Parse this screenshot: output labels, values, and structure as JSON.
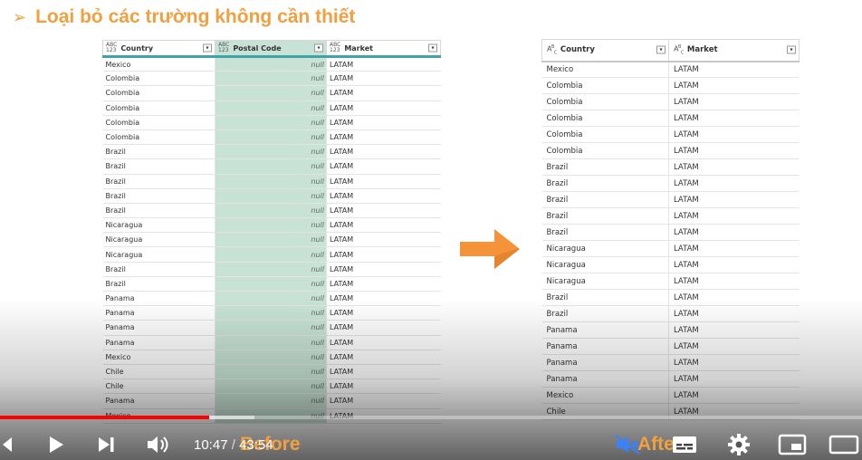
{
  "slide": {
    "bullet": "➢",
    "title": "Loại bỏ các trường không cần thiết"
  },
  "before_table": {
    "columns": [
      {
        "type": "ABC\n123",
        "label": "Country"
      },
      {
        "type": "ABC\n123",
        "label": "Postal Code"
      },
      {
        "type": "ABC\n123",
        "label": "Market"
      }
    ],
    "rows": [
      [
        "Mexico",
        "null",
        "LATAM"
      ],
      [
        "Colombia",
        "null",
        "LATAM"
      ],
      [
        "Colombia",
        "null",
        "LATAM"
      ],
      [
        "Colombia",
        "null",
        "LATAM"
      ],
      [
        "Colombia",
        "null",
        "LATAM"
      ],
      [
        "Colombia",
        "null",
        "LATAM"
      ],
      [
        "Brazil",
        "null",
        "LATAM"
      ],
      [
        "Brazil",
        "null",
        "LATAM"
      ],
      [
        "Brazil",
        "null",
        "LATAM"
      ],
      [
        "Brazil",
        "null",
        "LATAM"
      ],
      [
        "Brazil",
        "null",
        "LATAM"
      ],
      [
        "Nicaragua",
        "null",
        "LATAM"
      ],
      [
        "Nicaragua",
        "null",
        "LATAM"
      ],
      [
        "Nicaragua",
        "null",
        "LATAM"
      ],
      [
        "Brazil",
        "null",
        "LATAM"
      ],
      [
        "Brazil",
        "null",
        "LATAM"
      ],
      [
        "Panama",
        "null",
        "LATAM"
      ],
      [
        "Panama",
        "null",
        "LATAM"
      ],
      [
        "Panama",
        "null",
        "LATAM"
      ],
      [
        "Panama",
        "null",
        "LATAM"
      ],
      [
        "Mexico",
        "null",
        "LATAM"
      ],
      [
        "Chile",
        "null",
        "LATAM"
      ],
      [
        "Chile",
        "null",
        "LATAM"
      ],
      [
        "Panama",
        "null",
        "LATAM"
      ],
      [
        "Mexico",
        "null",
        "LATAM"
      ]
    ]
  },
  "after_table": {
    "columns": [
      {
        "type": "ABC",
        "label": "Country"
      },
      {
        "type": "ABC",
        "label": "Market"
      }
    ],
    "rows": [
      [
        "Mexico",
        "LATAM"
      ],
      [
        "Colombia",
        "LATAM"
      ],
      [
        "Colombia",
        "LATAM"
      ],
      [
        "Colombia",
        "LATAM"
      ],
      [
        "Colombia",
        "LATAM"
      ],
      [
        "Colombia",
        "LATAM"
      ],
      [
        "Brazil",
        "LATAM"
      ],
      [
        "Brazil",
        "LATAM"
      ],
      [
        "Brazil",
        "LATAM"
      ],
      [
        "Brazil",
        "LATAM"
      ],
      [
        "Brazil",
        "LATAM"
      ],
      [
        "Nicaragua",
        "LATAM"
      ],
      [
        "Nicaragua",
        "LATAM"
      ],
      [
        "Nicaragua",
        "LATAM"
      ],
      [
        "Brazil",
        "LATAM"
      ],
      [
        "Brazil",
        "LATAM"
      ],
      [
        "Panama",
        "LATAM"
      ],
      [
        "Panama",
        "LATAM"
      ],
      [
        "Panama",
        "LATAM"
      ],
      [
        "Panama",
        "LATAM"
      ],
      [
        "Mexico",
        "LATAM"
      ],
      [
        "Chile",
        "LATAM"
      ]
    ]
  },
  "captions": {
    "before": "Before",
    "after": "After"
  },
  "player": {
    "current_time": "10:47",
    "separator": " / ",
    "duration": "43:54",
    "played_fraction": 0.243,
    "buffered_fraction": 0.295,
    "icons": [
      "previous-icon",
      "play-icon",
      "next-icon",
      "volume-icon",
      "muted-icon",
      "subtitles-icon",
      "settings-icon",
      "miniplayer-icon",
      "theater-icon"
    ]
  },
  "colors": {
    "title_orange": "#f0a040",
    "arrow_orange": "#f5933a",
    "header_teal": "#3fa3a8",
    "postal_highlight": "#c8e3d6",
    "progress_red": "#ff0000"
  }
}
